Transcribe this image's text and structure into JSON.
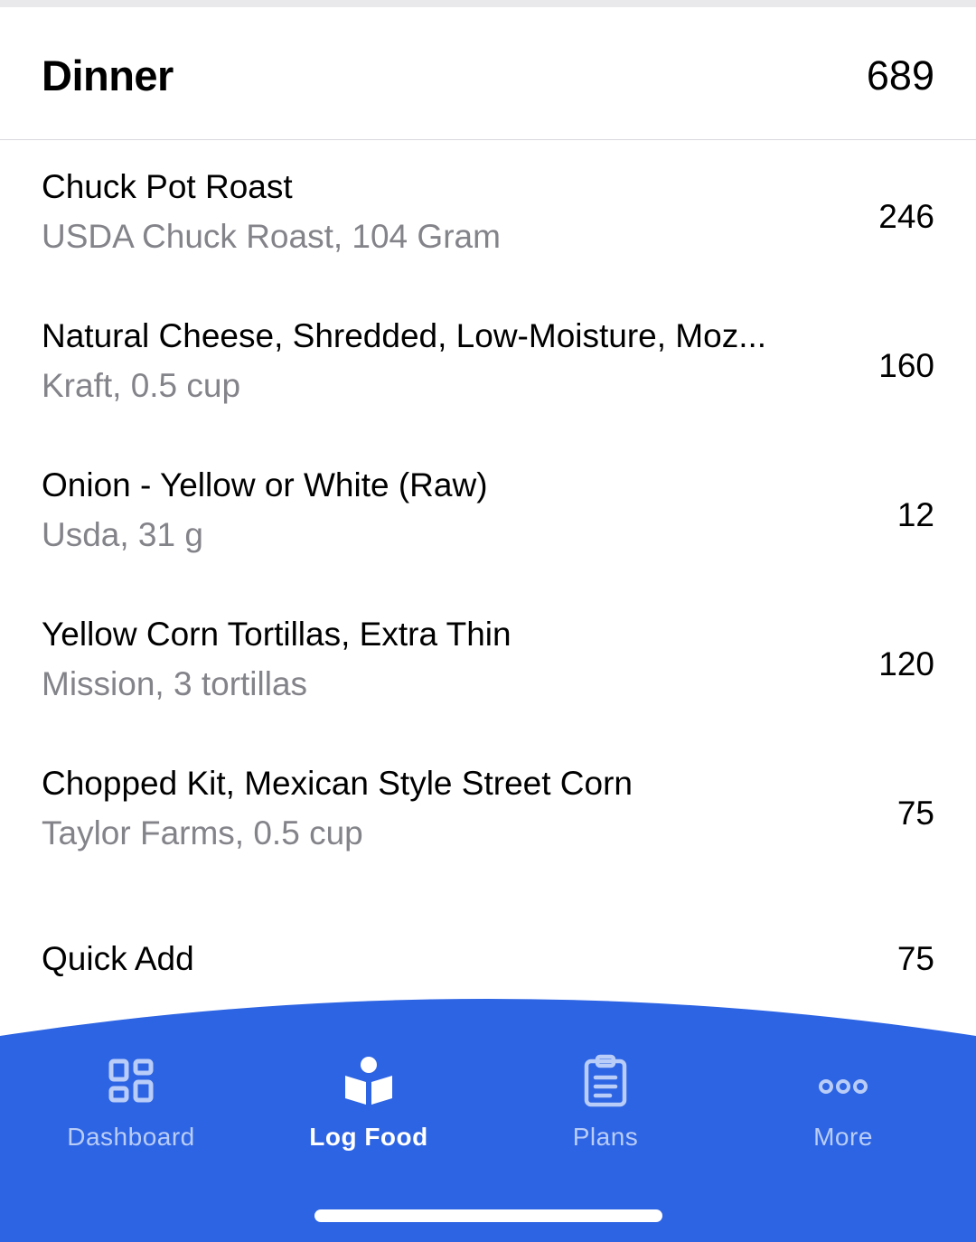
{
  "header": {
    "title": "Dinner",
    "total_calories": "689"
  },
  "food_items": [
    {
      "name": "Chuck Pot Roast",
      "detail": "USDA Chuck Roast, 104 Gram",
      "calories": "246"
    },
    {
      "name": "Natural Cheese, Shredded, Low-Moisture, Moz...",
      "detail": "Kraft, 0.5 cup",
      "calories": "160"
    },
    {
      "name": "Onion - Yellow or White (Raw)",
      "detail": "Usda, 31 g",
      "calories": "12"
    },
    {
      "name": "Yellow Corn Tortillas, Extra Thin",
      "detail": "Mission, 3 tortillas",
      "calories": "120"
    },
    {
      "name": "Chopped Kit, Mexican Style Street Corn",
      "detail": "Taylor Farms, 0.5 cup",
      "calories": "75"
    }
  ],
  "quick_add": {
    "label": "Quick Add",
    "calories": "75"
  },
  "tabs": [
    {
      "label": "Dashboard",
      "icon": "dashboard-grid-icon",
      "active": false
    },
    {
      "label": "Log Food",
      "icon": "book-icon",
      "active": true
    },
    {
      "label": "Plans",
      "icon": "clipboard-icon",
      "active": false
    },
    {
      "label": "More",
      "icon": "more-dots-icon",
      "active": false
    }
  ],
  "colors": {
    "tab_bar_bg": "#2d64e3",
    "secondary_text": "#83838a",
    "inactive_tab": "#b9cdf8",
    "active_tab": "#ffffff"
  }
}
